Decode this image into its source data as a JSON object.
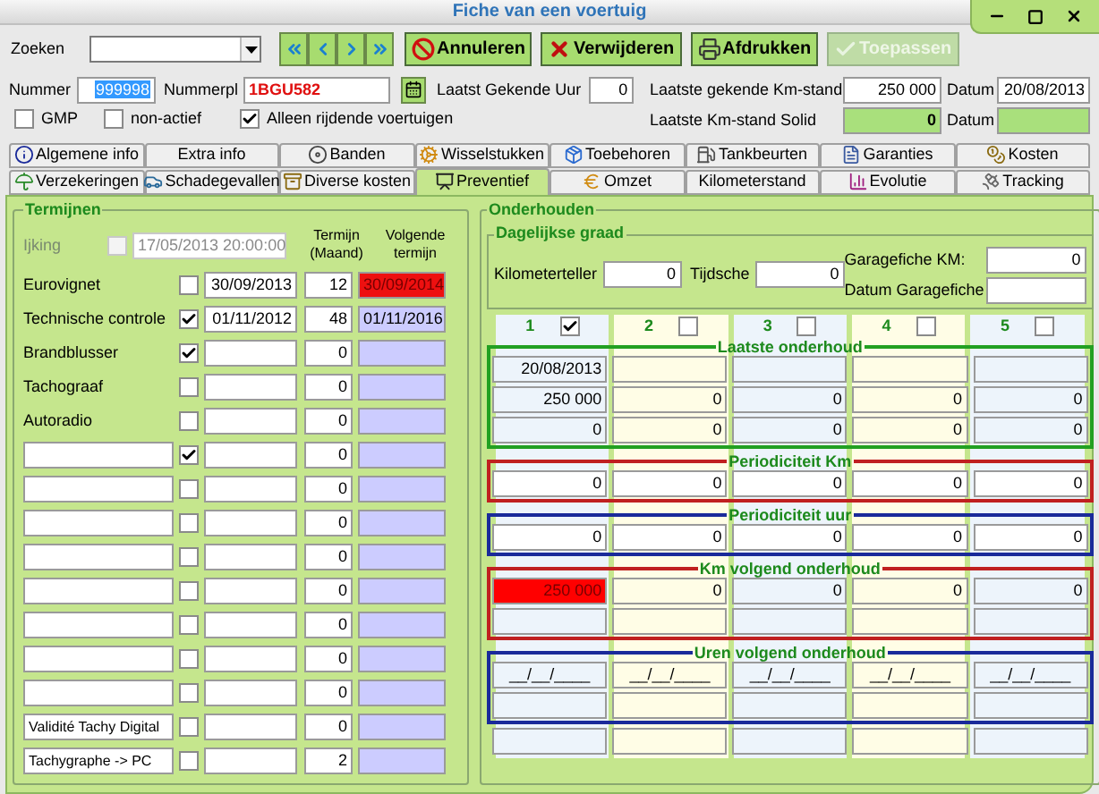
{
  "window": {
    "title": "Fiche van een voertuig"
  },
  "toolbar": {
    "search_label": "Zoeken",
    "buttons": [
      {
        "label": "Annuleren",
        "disabled": false
      },
      {
        "label": "Verwijderen",
        "disabled": false
      },
      {
        "label": "Afdrukken",
        "disabled": false
      },
      {
        "label": "Toepassen",
        "disabled": true
      }
    ]
  },
  "header": {
    "number_label": "Nummer",
    "number": "999998",
    "number_highlighted": true,
    "plate_label": "Nummerpl",
    "plate": "1BGU582",
    "hour_label": "Laatst Gekende Uur",
    "hour": "0",
    "km_label": "Laatste gekende Km-stand",
    "km": "250 000",
    "km_date_label": "Datum",
    "km_date": "20/08/2013",
    "solid_label": "Laatste Km-stand Solid",
    "solid": "0",
    "solid_date_label": "Datum"
  },
  "flags": [
    {
      "label": "GMP",
      "checked": false
    },
    {
      "label": "non-actief",
      "checked": false
    },
    {
      "label": "Alleen rijdende voertuigen",
      "checked": true
    }
  ],
  "tab_rows": [
    [
      {
        "label": "Algemene info",
        "selected": false
      },
      {
        "label": "Extra info",
        "selected": false
      },
      {
        "label": "Banden",
        "selected": false
      },
      {
        "label": "Wisselstukken",
        "selected": false
      },
      {
        "label": "Toebehoren",
        "selected": false
      },
      {
        "label": "Tankbeurten",
        "selected": false
      },
      {
        "label": "Garanties",
        "selected": false
      },
      {
        "label": "Kosten",
        "selected": false
      }
    ],
    [
      {
        "label": "Verzekeringen",
        "selected": false
      },
      {
        "label": "Schadegevallen",
        "selected": false
      },
      {
        "label": "Diverse kosten",
        "selected": false
      },
      {
        "label": "Preventief",
        "selected": true
      },
      {
        "label": "Omzet",
        "selected": false
      },
      {
        "label": "Kilometerstand",
        "selected": false
      },
      {
        "label": "Evolutie",
        "selected": false
      },
      {
        "label": "Tracking",
        "selected": false
      }
    ]
  ],
  "termijnen": {
    "title": "Termijnen",
    "term_header": "Termijn (Maand)",
    "next_header": "Volgende termijn",
    "calibration": {
      "label": "Ijking",
      "disabled": true,
      "checked": false,
      "date": "17/05/2013 20:00:00"
    },
    "rows": [
      {
        "kind": "text",
        "label": "Eurovignet",
        "checked": false,
        "date": "30/09/2013",
        "term": "12",
        "next": "30/09/2014",
        "overdue": true
      },
      {
        "kind": "text",
        "label": "Technische controle",
        "checked": true,
        "date": "01/11/2012",
        "term": "48",
        "next": "01/11/2016",
        "overdue": false
      },
      {
        "kind": "text",
        "label": "Brandblusser",
        "checked": true,
        "term": "0",
        "overdue": false
      },
      {
        "kind": "text",
        "label": "Tachograaf",
        "checked": false,
        "term": "0",
        "overdue": false
      },
      {
        "kind": "text",
        "label": "Autoradio",
        "checked": false,
        "term": "0",
        "overdue": false
      },
      {
        "kind": "field",
        "checked": true,
        "term": "0",
        "overdue": false
      },
      {
        "kind": "field",
        "checked": false,
        "term": "0",
        "overdue": false
      },
      {
        "kind": "field",
        "checked": false,
        "term": "0",
        "overdue": false
      },
      {
        "kind": "field",
        "checked": false,
        "term": "0",
        "overdue": false
      },
      {
        "kind": "field",
        "checked": false,
        "term": "0",
        "overdue": false
      },
      {
        "kind": "field",
        "checked": false,
        "term": "0",
        "overdue": false
      },
      {
        "kind": "field",
        "checked": false,
        "term": "0",
        "overdue": false
      },
      {
        "kind": "field",
        "checked": false,
        "term": "0",
        "overdue": false
      },
      {
        "kind": "field",
        "label": "Validité Tachy Digital",
        "checked": false,
        "term": "0",
        "overdue": false
      },
      {
        "kind": "field",
        "label": "Tachygraphe -> PC",
        "checked": false,
        "term": "2",
        "overdue": false
      }
    ]
  },
  "onderhouden": {
    "title": "Onderhouden",
    "daily": {
      "title": "Dagelijkse graad",
      "odometer_label": "Kilometerteller",
      "odometer": "0",
      "time_label": "Tijdsche",
      "time": "0",
      "garage_km_label": "Garagefiche KM:",
      "garage_km": "0",
      "garage_date_label": "Datum Garagefiche"
    },
    "columns": [
      {
        "label": "1",
        "checked": true
      },
      {
        "label": "2",
        "checked": false
      },
      {
        "label": "3",
        "checked": false
      },
      {
        "label": "4",
        "checked": false
      },
      {
        "label": "5",
        "checked": false
      }
    ],
    "sections": [
      {
        "title": "Laatste onderhoud",
        "color": "#22a022",
        "kind": "tinted",
        "rows": [
          [
            {
              "value": "20/08/2013",
              "alert": false
            },
            {
              "alert": false
            },
            {
              "alert": false
            },
            {
              "alert": false
            },
            {
              "alert": false
            }
          ],
          [
            {
              "value": "250 000",
              "alert": false
            },
            {
              "value": "0",
              "alert": false
            },
            {
              "value": "0",
              "alert": false
            },
            {
              "value": "0",
              "alert": false
            },
            {
              "value": "0",
              "alert": false
            }
          ],
          [
            {
              "value": "0",
              "alert": false
            },
            {
              "value": "0",
              "alert": false
            },
            {
              "value": "0",
              "alert": false
            },
            {
              "value": "0",
              "alert": false
            },
            {
              "value": "0",
              "alert": false
            }
          ]
        ]
      },
      {
        "title": "Periodiciteit Km",
        "color": "#c02020",
        "kind": "plain",
        "rows": [
          [
            {
              "value": "0",
              "alert": false
            },
            {
              "value": "0",
              "alert": false
            },
            {
              "value": "0",
              "alert": false
            },
            {
              "value": "0",
              "alert": false
            },
            {
              "value": "0",
              "alert": false
            }
          ]
        ]
      },
      {
        "title": "Periodiciteit uur",
        "color": "#1a2a9a",
        "kind": "plain",
        "rows": [
          [
            {
              "value": "0",
              "alert": false
            },
            {
              "value": "0",
              "alert": false
            },
            {
              "value": "0",
              "alert": false
            },
            {
              "value": "0",
              "alert": false
            },
            {
              "value": "0",
              "alert": false
            }
          ]
        ]
      },
      {
        "title": "Km volgend onderhoud",
        "color": "#c02020",
        "kind": "tinted",
        "rows": [
          [
            {
              "value": "250 000",
              "alert": true
            },
            {
              "value": "0",
              "alert": false
            },
            {
              "value": "0",
              "alert": false
            },
            {
              "value": "0",
              "alert": false
            },
            {
              "value": "0",
              "alert": false
            }
          ],
          [
            {
              "alert": false
            },
            {
              "alert": false
            },
            {
              "alert": false
            },
            {
              "alert": false
            },
            {
              "alert": false
            }
          ]
        ]
      },
      {
        "title": "Uren volgend onderhoud",
        "color": "#1a2a9a",
        "kind": "tinted",
        "rows": [
          [
            {
              "value": "__/__/____",
              "alert": false
            },
            {
              "value": "__/__/____",
              "alert": false
            },
            {
              "value": "__/__/____",
              "alert": false
            },
            {
              "value": "__/__/____",
              "alert": false
            },
            {
              "value": "__/__/____",
              "alert": false
            }
          ],
          [
            {
              "alert": false
            },
            {
              "alert": false
            },
            {
              "alert": false
            },
            {
              "alert": false
            },
            {
              "alert": false
            }
          ]
        ]
      }
    ]
  }
}
